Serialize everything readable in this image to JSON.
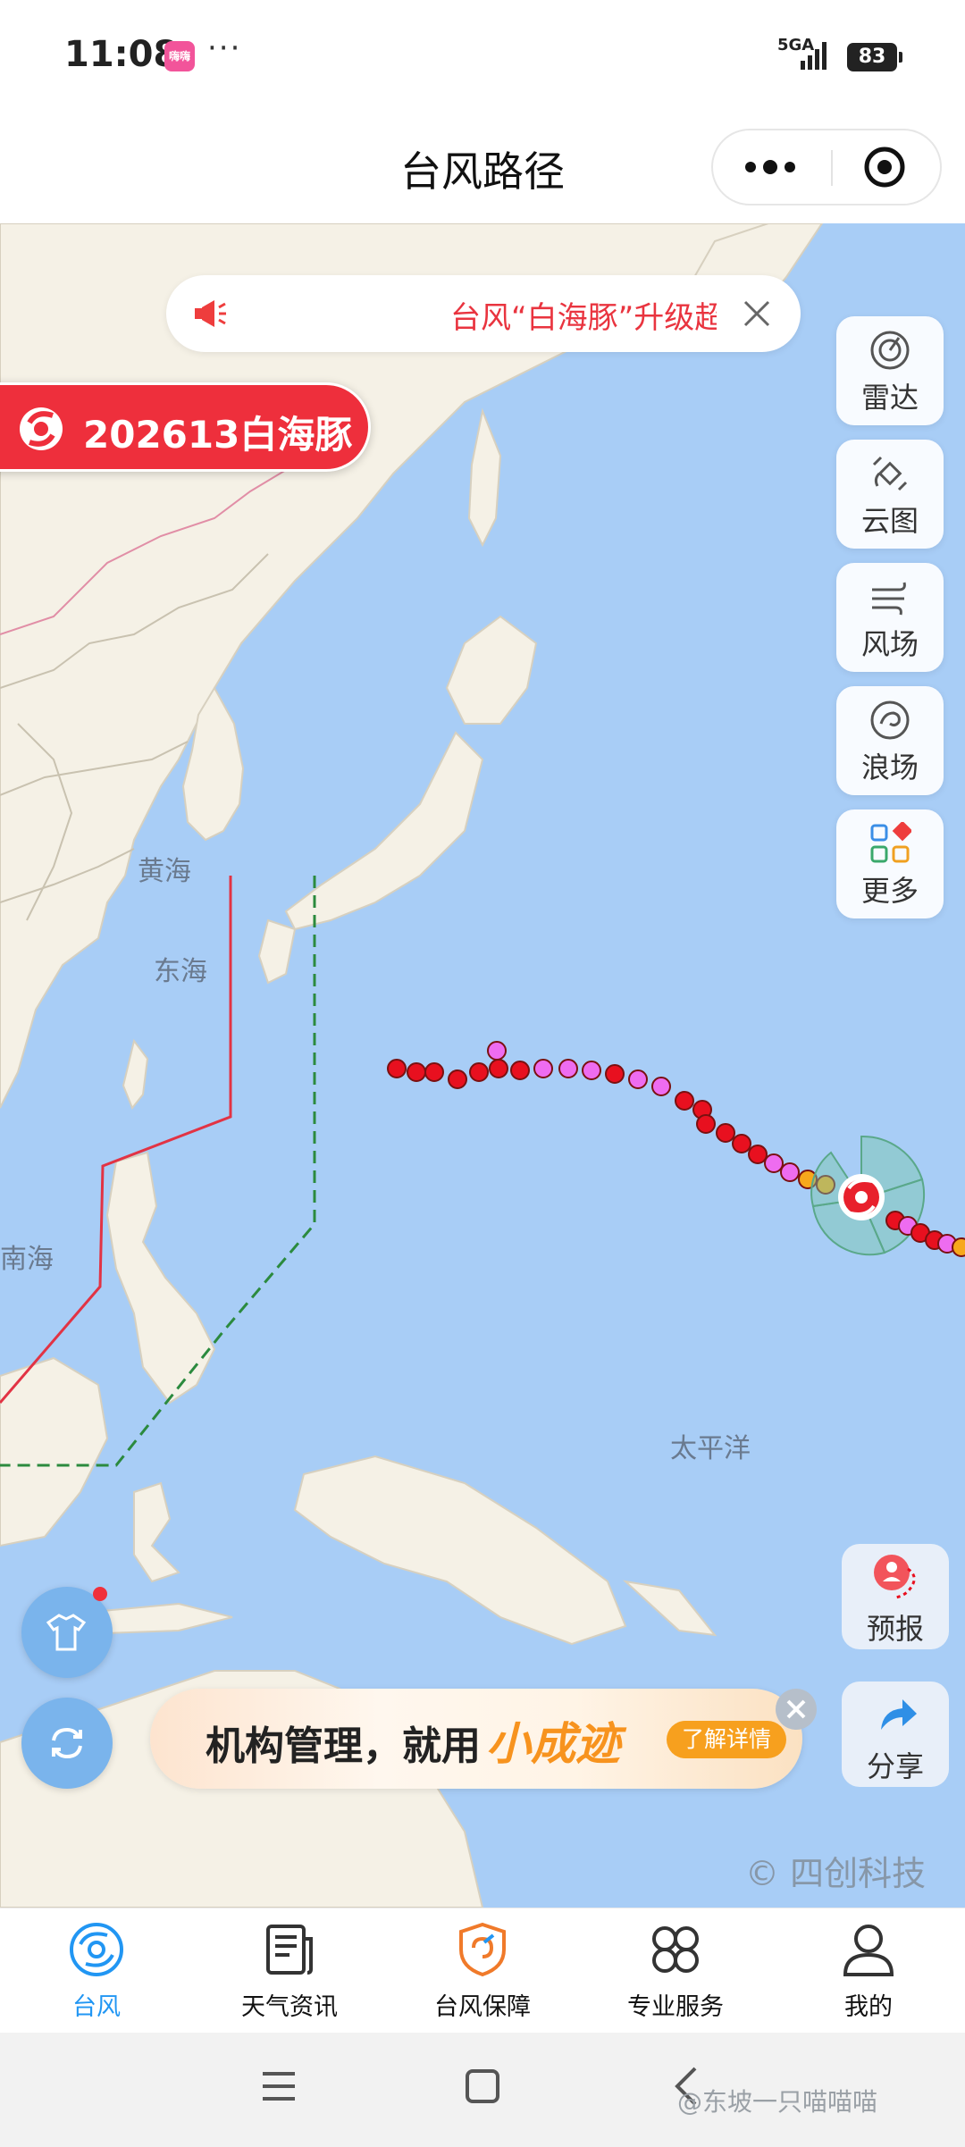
{
  "status_bar": {
    "time": "11:08",
    "app_badge": "嗨嗨",
    "dots": "···",
    "network": "5GA",
    "battery": "83"
  },
  "title_bar": {
    "title": "台风路径"
  },
  "map": {
    "labels": {
      "yellow_sea": "黄海",
      "east_sea": "东海",
      "south_sea": "南海",
      "pacific": "太平洋"
    },
    "notice": {
      "text": "台风“白海豚”升级超强台风"
    },
    "typhoon": {
      "label": "202613白海豚",
      "accent": "#ee2f3c"
    },
    "tools": [
      {
        "label": "雷达",
        "icon": "radar-icon"
      },
      {
        "label": "云图",
        "icon": "satellite-icon"
      },
      {
        "label": "风场",
        "icon": "wind-icon"
      },
      {
        "label": "浪场",
        "icon": "wave-icon"
      },
      {
        "label": "更多",
        "icon": "more-grid-icon"
      }
    ],
    "forecast_label": "预报",
    "share_label": "分享",
    "ad": {
      "text": "机构管理，就用",
      "brand": "小成迹",
      "cta": "了解详情"
    },
    "watermark": "© 四创科技",
    "track_colors": {
      "red": "#e8101f",
      "magenta": "#ee6cf0",
      "orange": "#f7a81c"
    }
  },
  "tabbar": {
    "tabs": [
      {
        "label": "台风",
        "icon": "typhoon-icon",
        "active": true
      },
      {
        "label": "天气资讯",
        "icon": "news-icon"
      },
      {
        "label": "台风保障",
        "icon": "shield-icon"
      },
      {
        "label": "专业服务",
        "icon": "service-icon"
      },
      {
        "label": "我的",
        "icon": "user-icon"
      }
    ],
    "active_color": "#2196f3"
  },
  "footer_mark": "@东坡一只喵喵喵"
}
